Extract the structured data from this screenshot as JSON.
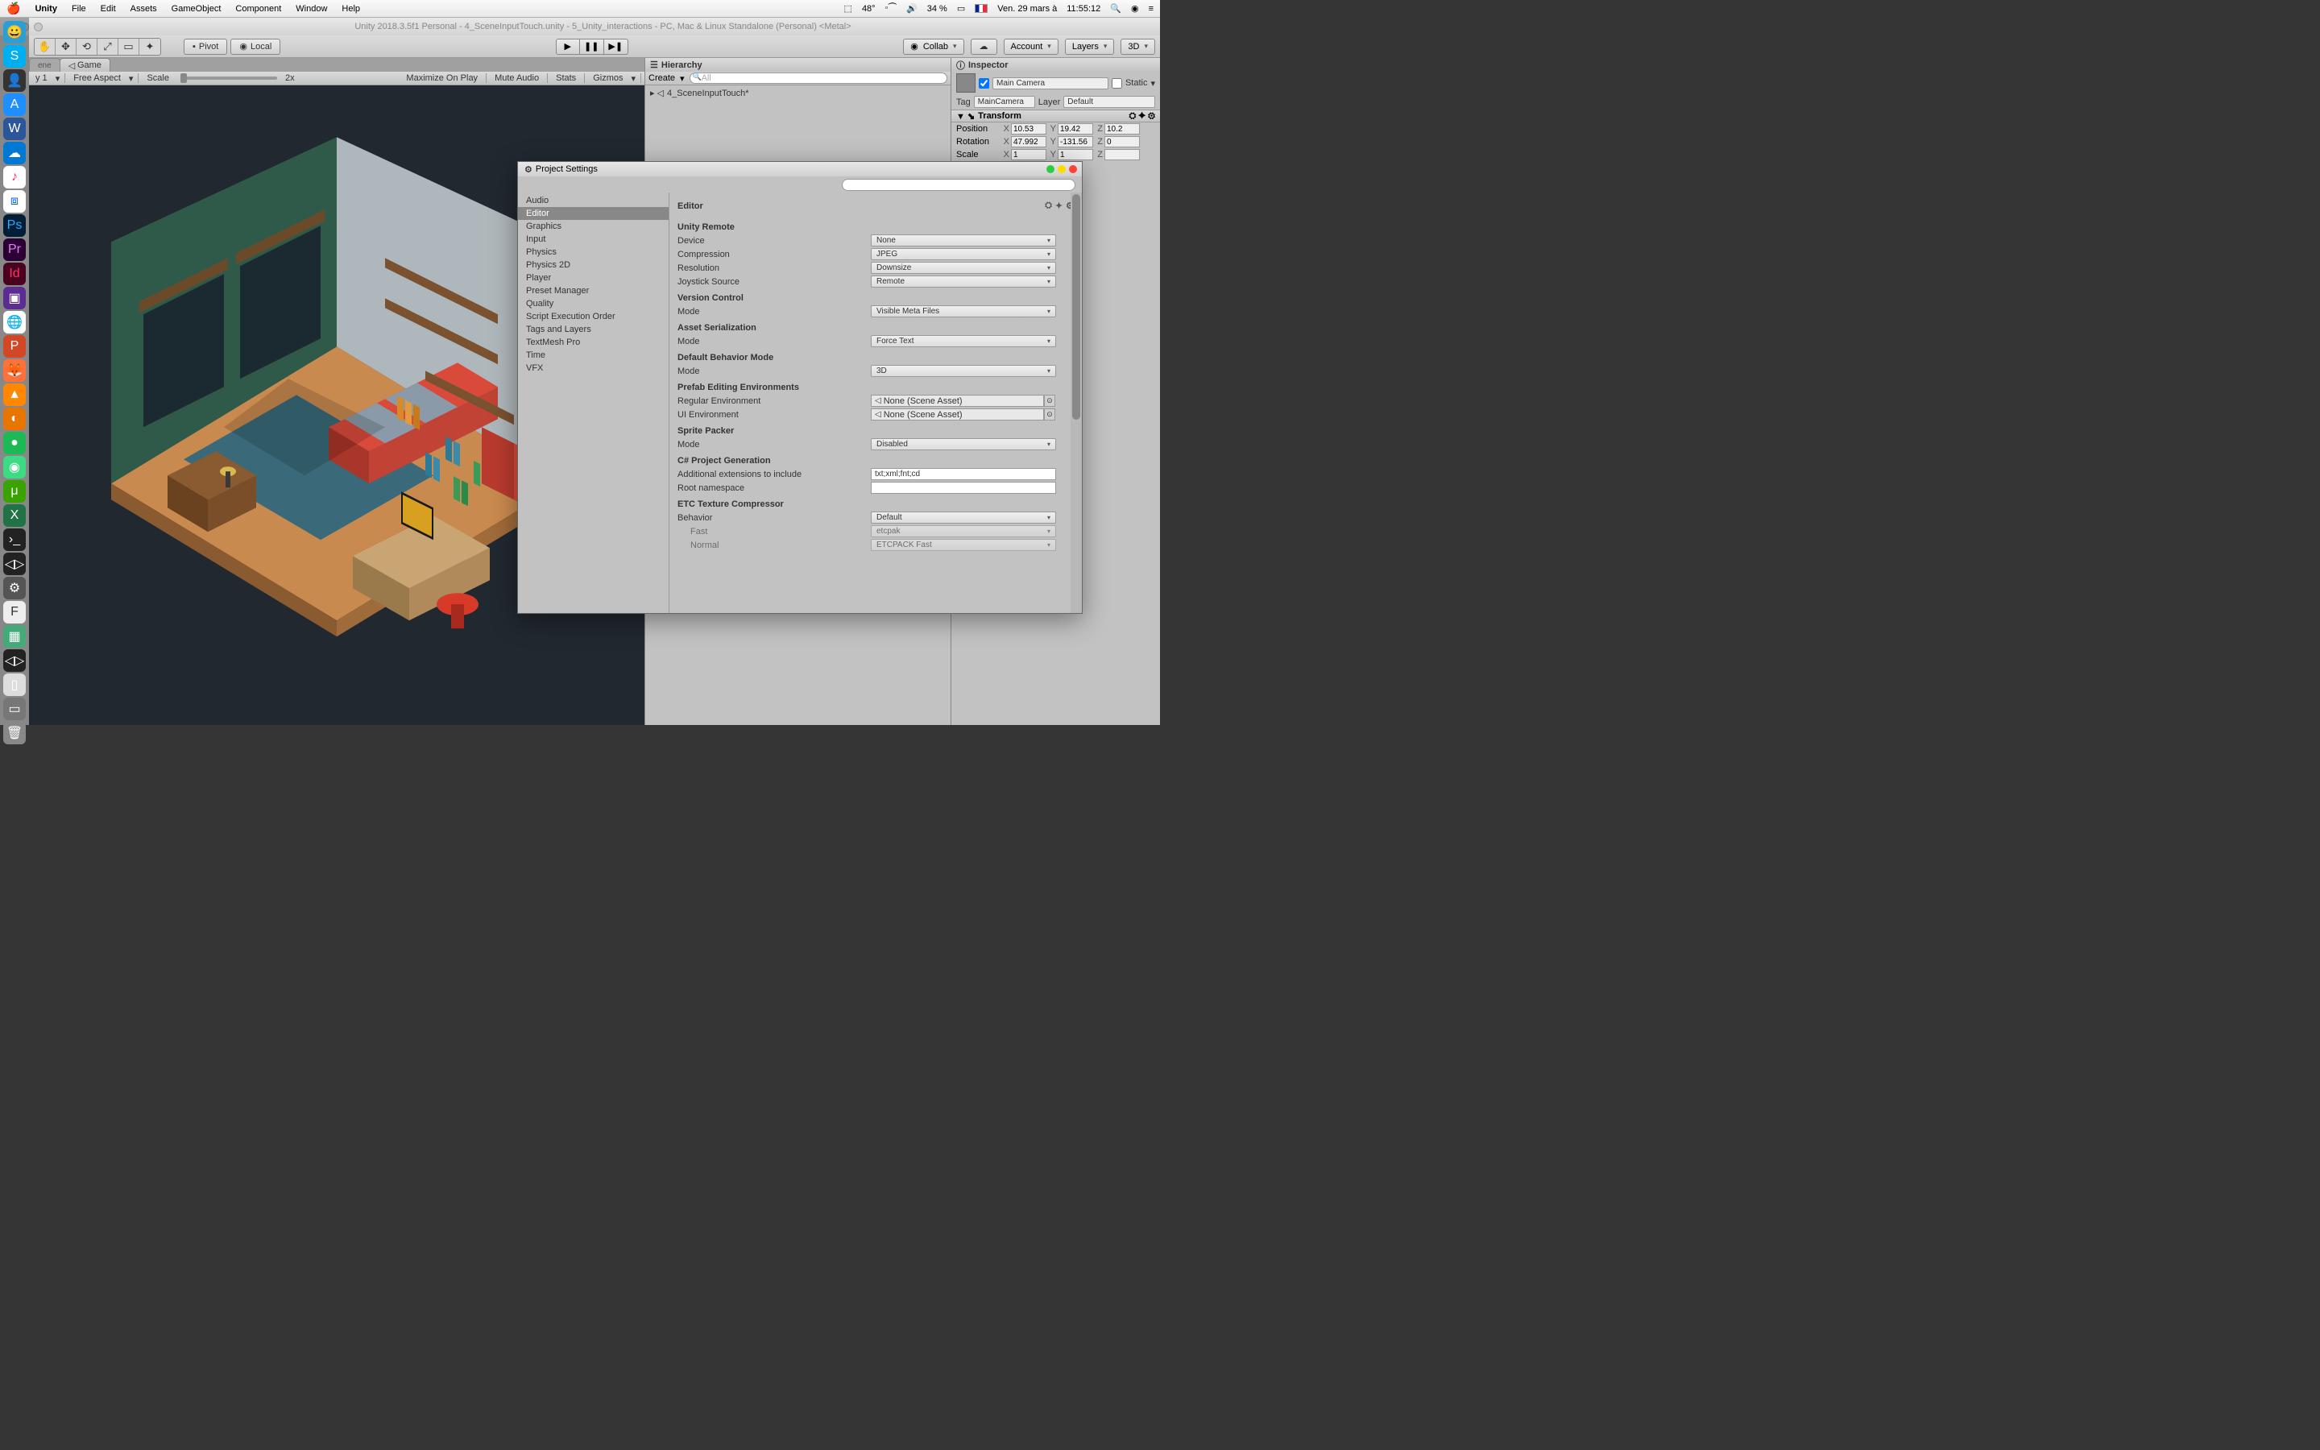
{
  "menubar": {
    "app": "Unity",
    "items": [
      "File",
      "Edit",
      "Assets",
      "GameObject",
      "Component",
      "Window",
      "Help"
    ],
    "temp": "48°",
    "battery": "34 %",
    "date": "Ven. 29 mars à",
    "time": "11:55:12"
  },
  "window": {
    "title": "Unity 2018.3.5f1 Personal - 4_SceneInputTouch.unity - 5_Unity_interactions - PC, Mac & Linux Standalone (Personal) <Metal>"
  },
  "toolbar": {
    "pivot": "Pivot",
    "local": "Local",
    "collab": "Collab",
    "account": "Account",
    "layers": "Layers",
    "layout": "3D"
  },
  "gameTab": {
    "tab1": "ene",
    "tab1b": "Game",
    "display": "y 1",
    "aspect": "Free Aspect",
    "scale": "Scale",
    "scaleVal": "2x",
    "opts": [
      "Maximize On Play",
      "Mute Audio",
      "Stats",
      "Gizmos"
    ]
  },
  "hierarchy": {
    "title": "Hierarchy",
    "create": "Create",
    "search": "All",
    "scene": "4_SceneInputTouch*"
  },
  "inspector": {
    "title": "Inspector",
    "objName": "Main Camera",
    "static": "Static",
    "tagLabel": "Tag",
    "tag": "MainCamera",
    "layerLabel": "Layer",
    "layer": "Default",
    "transform": "Transform",
    "position": "Position",
    "rotation": "Rotation",
    "scale": "Scale",
    "pos": {
      "x": "10.53",
      "y": "19.42",
      "z": "10.2"
    },
    "rot": {
      "x": "47.992",
      "y": "-131.56",
      "z": "0"
    },
    "scl": {
      "x": "1",
      "y": "1",
      "z": ""
    }
  },
  "projectSettings": {
    "title": "Project Settings",
    "categories": [
      "Audio",
      "Editor",
      "Graphics",
      "Input",
      "Physics",
      "Physics 2D",
      "Player",
      "Preset Manager",
      "Quality",
      "Script Execution Order",
      "Tags and Layers",
      "TextMesh Pro",
      "Time",
      "VFX"
    ],
    "selectedCategory": "Editor",
    "heading": "Editor",
    "sections": {
      "unityRemote": {
        "title": "Unity Remote",
        "device": {
          "label": "Device",
          "value": "None"
        },
        "compression": {
          "label": "Compression",
          "value": "JPEG"
        },
        "resolution": {
          "label": "Resolution",
          "value": "Downsize"
        },
        "joystick": {
          "label": "Joystick Source",
          "value": "Remote"
        }
      },
      "versionControl": {
        "title": "Version Control",
        "mode": {
          "label": "Mode",
          "value": "Visible Meta Files"
        }
      },
      "assetSerialization": {
        "title": "Asset Serialization",
        "mode": {
          "label": "Mode",
          "value": "Force Text"
        }
      },
      "defaultBehavior": {
        "title": "Default Behavior Mode",
        "mode": {
          "label": "Mode",
          "value": "3D"
        }
      },
      "prefabEnv": {
        "title": "Prefab Editing Environments",
        "regular": {
          "label": "Regular Environment",
          "value": "None (Scene Asset)"
        },
        "ui": {
          "label": "UI Environment",
          "value": "None (Scene Asset)"
        }
      },
      "spritePacker": {
        "title": "Sprite Packer",
        "mode": {
          "label": "Mode",
          "value": "Disabled"
        }
      },
      "csharp": {
        "title": "C# Project Generation",
        "ext": {
          "label": "Additional extensions to include",
          "value": "txt;xml;fnt;cd"
        },
        "root": {
          "label": "Root namespace",
          "value": ""
        }
      },
      "etc": {
        "title": "ETC Texture Compressor",
        "behavior": {
          "label": "Behavior",
          "value": "Default"
        },
        "fast": {
          "label": "Fast",
          "value": "etcpak"
        },
        "normal": {
          "label": "Normal",
          "value": "ETCPACK Fast"
        }
      }
    }
  }
}
